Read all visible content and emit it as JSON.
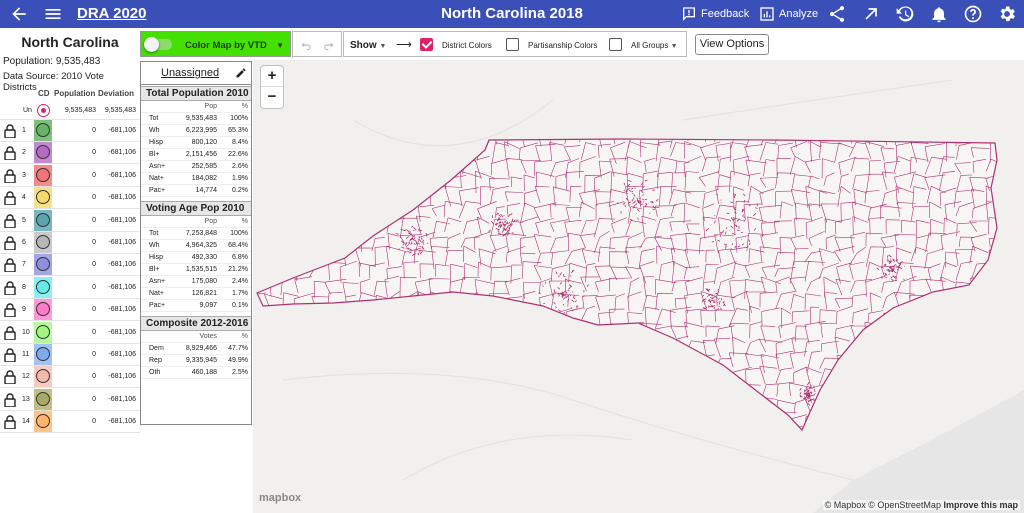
{
  "app": {
    "brand": "DRA 2020",
    "title": "North Carolina 2018"
  },
  "header": {
    "menu_icon": "hamburger-icon",
    "back_icon": "arrow-left-icon",
    "feedback_label": "Feedback",
    "analyze_label": "Analyze",
    "icons": [
      "share-icon",
      "expand-icon",
      "history-icon",
      "bell-icon",
      "help-icon",
      "gear-icon"
    ]
  },
  "left": {
    "state": "North Carolina",
    "population": "Population: 9,535,483",
    "source": "Data Source: 2010 Vote Districts",
    "headers": {
      "cd": "CD",
      "population": "Population",
      "deviation": "Deviation"
    },
    "unassigned": {
      "label": "Un",
      "population": "9,535,483",
      "deviation": "9,535,483",
      "color": "#e0216a"
    },
    "districts": [
      {
        "num": "1",
        "pop": "0",
        "dev": "-681,106",
        "color": "#43a047",
        "bg": "#7fbf7b"
      },
      {
        "num": "2",
        "pop": "0",
        "dev": "-681,106",
        "color": "#a23cb4",
        "bg": "#c28bd0"
      },
      {
        "num": "3",
        "pop": "0",
        "dev": "-681,106",
        "color": "#f05060",
        "bg": "#f48b8b"
      },
      {
        "num": "4",
        "pop": "0",
        "dev": "-681,106",
        "color": "#f5d142",
        "bg": "#f6e28a"
      },
      {
        "num": "5",
        "pop": "0",
        "dev": "-681,106",
        "color": "#2f8a96",
        "bg": "#78b6c0"
      },
      {
        "num": "6",
        "pop": "0",
        "dev": "-681,106",
        "color": "#9a9a9a",
        "bg": "#c9c9c9"
      },
      {
        "num": "7",
        "pop": "0",
        "dev": "-681,106",
        "color": "#6e6fd6",
        "bg": "#a4a6e6"
      },
      {
        "num": "8",
        "pop": "0",
        "dev": "-681,106",
        "color": "#2ee0e0",
        "bg": "#8cf0f0"
      },
      {
        "num": "9",
        "pop": "0",
        "dev": "-681,106",
        "color": "#ff4fb8",
        "bg": "#ff98d8"
      },
      {
        "num": "10",
        "pop": "0",
        "dev": "-681,106",
        "color": "#7ff050",
        "bg": "#b8f8a0"
      },
      {
        "num": "11",
        "pop": "0",
        "dev": "-681,106",
        "color": "#4a86e8",
        "bg": "#a2c2f4"
      },
      {
        "num": "12",
        "pop": "0",
        "dev": "-681,106",
        "color": "#f0a08c",
        "bg": "#f6ccc0"
      },
      {
        "num": "13",
        "pop": "0",
        "dev": "-681,106",
        "color": "#8a8a40",
        "bg": "#bfbf84"
      },
      {
        "num": "14",
        "pop": "0",
        "dev": "-681,106",
        "color": "#ff9a3c",
        "bg": "#ffc48a"
      }
    ]
  },
  "toolbar": {
    "color_map_label": "Color Map by VTD",
    "show_label": "Show",
    "district_colors": "District Colors",
    "partisanship_colors": "Partisanship Colors",
    "all_groups": "All Groups",
    "view_options": "View Options",
    "district_colors_checked": true,
    "partisanship_checked": false,
    "all_groups_checked": false
  },
  "stats": {
    "title": "Unassigned",
    "total_pop": {
      "heading": "Total Population 2010",
      "col_pop": "Pop",
      "col_pct": "%",
      "rows": [
        {
          "k": "Tot",
          "v": "9,535,483",
          "p": "100%"
        },
        {
          "k": "Wh",
          "v": "6,223,995",
          "p": "65.3%"
        },
        {
          "k": "Hisp",
          "v": "800,120",
          "p": "8.4%"
        },
        {
          "k": "Bl+",
          "v": "2,151,456",
          "p": "22.6%"
        },
        {
          "k": "Asn+",
          "v": "252,585",
          "p": "2.6%"
        },
        {
          "k": "Nat+",
          "v": "184,082",
          "p": "1.9%"
        },
        {
          "k": "Pac+",
          "v": "14,774",
          "p": "0.2%"
        }
      ]
    },
    "vap": {
      "heading": "Voting Age Pop 2010",
      "col_pop": "Pop",
      "col_pct": "%",
      "rows": [
        {
          "k": "Tot",
          "v": "7,253,848",
          "p": "100%"
        },
        {
          "k": "Wh",
          "v": "4,964,325",
          "p": "68.4%"
        },
        {
          "k": "Hisp",
          "v": "492,330",
          "p": "6.8%"
        },
        {
          "k": "Bl+",
          "v": "1,535,515",
          "p": "21.2%"
        },
        {
          "k": "Asn+",
          "v": "175,080",
          "p": "2.4%"
        },
        {
          "k": "Nat+",
          "v": "126,821",
          "p": "1.7%"
        },
        {
          "k": "Pac+",
          "v": "9,097",
          "p": "0.1%"
        }
      ]
    },
    "composite": {
      "heading": "Composite 2012-2016",
      "col_pop": "Votes",
      "col_pct": "%",
      "rows": [
        {
          "k": "Dem",
          "v": "8,929,466",
          "p": "47.7%"
        },
        {
          "k": "Rep",
          "v": "9,335,945",
          "p": "49.9%"
        },
        {
          "k": "Oth",
          "v": "460,188",
          "p": "2.5%"
        }
      ]
    }
  },
  "map": {
    "logo": "mapbox",
    "attribution_1": "© Mapbox © OpenStreetMap",
    "attribution_2": "Improve this map",
    "zoom_in": "+",
    "zoom_out": "−",
    "vtd_color": "#b03070"
  }
}
